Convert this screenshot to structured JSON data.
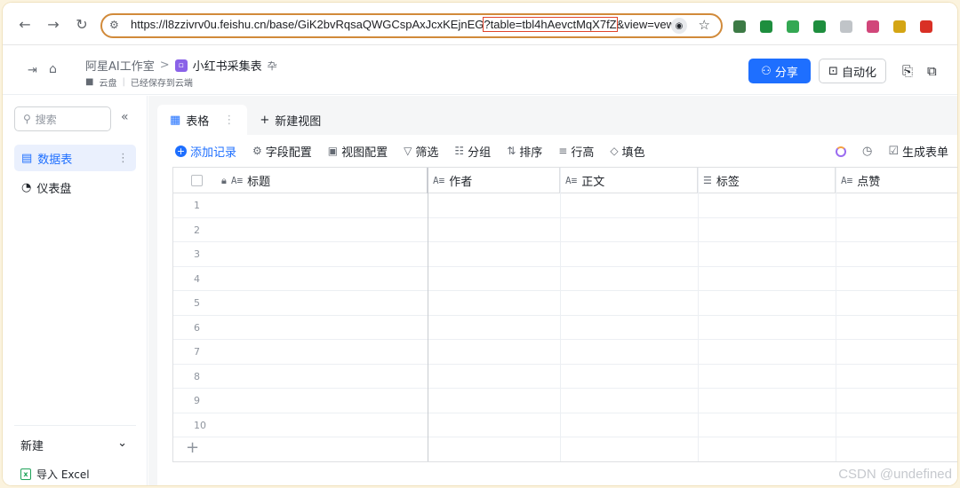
{
  "browser": {
    "url_before": "https://l8zzivrv0u.feishu.cn/base/GiK2bvRqsaQWGCspAxJcxKEjnEG",
    "url_highlight": "?table=tbl4hAevctMqX7fZ",
    "url_after": "&view=vewk",
    "back_icon": "arrow-left-icon",
    "forward_icon": "arrow-right-icon",
    "reload_icon": "reload-icon",
    "extension_colors": [
      "#3c7a45",
      "#1e8e3e",
      "#34a853",
      "#1e8e3e",
      "#c0c4c8",
      "#d1467a",
      "#d4a514",
      "#d93025"
    ]
  },
  "header": {
    "workspace": "阿星AI工作室",
    "separator": ">",
    "app_badge": "▫",
    "base_title": "小红书采集表",
    "pin_icon": "卆",
    "location": "云盘",
    "save_status": "已经保存到云端",
    "share_label": "分享",
    "automation_label": "自动化"
  },
  "sidebar": {
    "search_placeholder": "搜索",
    "items": [
      {
        "label": "数据表",
        "active": true
      },
      {
        "label": "仪表盘",
        "active": false
      }
    ],
    "new_label": "新建",
    "import_label": "导入 Excel"
  },
  "tabs": [
    {
      "label": "表格"
    },
    {
      "label": "新建视图"
    }
  ],
  "toolbar": {
    "add_record": "添加记录",
    "field_config": "字段配置",
    "view_config": "视图配置",
    "filter": "筛选",
    "group": "分组",
    "sort": "排序",
    "row_height": "行高",
    "fill_color": "填色",
    "generate_form": "生成表单"
  },
  "columns": [
    {
      "label": "标题",
      "type_icon": "A≡"
    },
    {
      "label": "作者",
      "type_icon": "A≡"
    },
    {
      "label": "正文",
      "type_icon": "A≡"
    },
    {
      "label": "标签",
      "type_icon": "☰"
    },
    {
      "label": "点赞",
      "type_icon": "A≡"
    }
  ],
  "rows": [
    "1",
    "2",
    "3",
    "4",
    "5",
    "6",
    "7",
    "8",
    "9",
    "10"
  ],
  "add_row_symbol": "+",
  "watermark": "CSDN @undefined",
  "colors": {
    "accent": "#1e6fff",
    "address_border": "#d18a3a",
    "url_highlight_border": "#e0442b",
    "background": "#fbf3de"
  }
}
